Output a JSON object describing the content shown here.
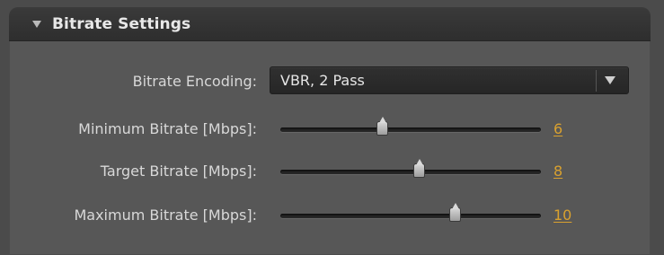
{
  "panel": {
    "title": "Bitrate Settings"
  },
  "fields": {
    "bitrate_encoding": {
      "label": "Bitrate Encoding:",
      "value": "VBR, 2 Pass"
    },
    "minimum_bitrate": {
      "label": "Minimum Bitrate [Mbps]:",
      "value": "6",
      "slider_level": 0.39
    },
    "target_bitrate": {
      "label": "Target Bitrate [Mbps]:",
      "value": "8",
      "slider_level": 0.53
    },
    "maximum_bitrate": {
      "label": "Maximum Bitrate [Mbps]:",
      "value": "10",
      "slider_level": 0.67
    }
  },
  "colors": {
    "panel": "#575757",
    "header": "#2e2e2e",
    "value_accent": "#d9a12f"
  },
  "icons": {
    "collapse": "triangle-down-icon",
    "dropdown": "chevron-down-icon",
    "slider_handle": "slider-thumb-icon"
  }
}
